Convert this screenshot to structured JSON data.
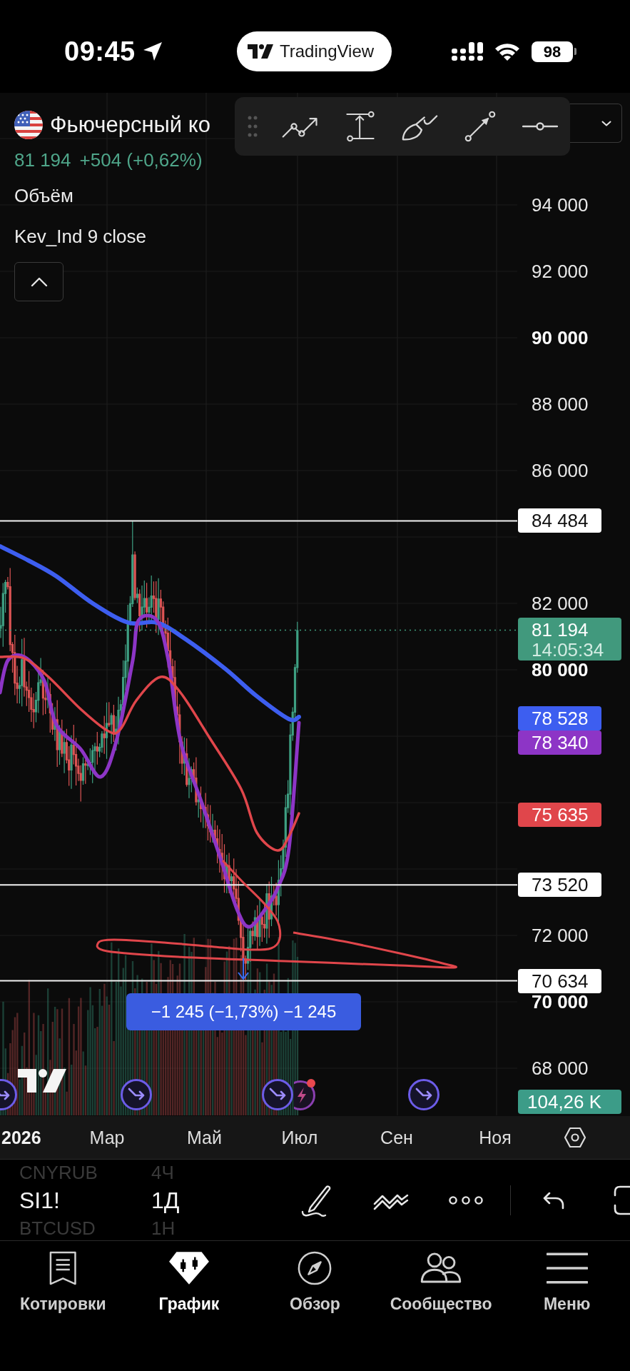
{
  "status_bar": {
    "time": "09:45",
    "app_name": "TradingView",
    "battery": "98"
  },
  "symbol": {
    "name": "Фьючерсный ко",
    "price": "81 194",
    "change": "+504 (+0,62%)"
  },
  "legend": [
    "Объём",
    "Kev_Ind 9 close"
  ],
  "chart": {
    "price_axis": [
      {
        "label": "94 000",
        "major": false
      },
      {
        "label": "92 000",
        "major": false
      },
      {
        "label": "90 000",
        "major": true
      },
      {
        "label": "88 000",
        "major": false
      },
      {
        "label": "86 000",
        "major": false
      },
      {
        "label": "82 000",
        "major": false
      },
      {
        "label": "80 000",
        "major": true
      },
      {
        "label": "72 000",
        "major": false
      },
      {
        "label": "70 000",
        "major": true
      },
      {
        "label": "68 000",
        "major": false
      }
    ],
    "levels": [
      "84 484",
      "73 520",
      "70 634"
    ],
    "last_price": {
      "price": "81 194",
      "countdown": "14:05:34"
    },
    "indicators": [
      {
        "value": "78 528",
        "color": "#3d5ef0"
      },
      {
        "value": "78 340",
        "color": "#8d35c6"
      },
      {
        "value": "75 635",
        "color": "#e0464b"
      }
    ],
    "volume": "104,26 K",
    "measure": "−1 245 (−1,73%) −1 245",
    "time_axis": [
      {
        "label": "2026",
        "major": true
      },
      {
        "label": "Мар",
        "major": false
      },
      {
        "label": "Май",
        "major": false
      },
      {
        "label": "Июл",
        "major": false
      },
      {
        "label": "Сен",
        "major": false
      },
      {
        "label": "Ноя",
        "major": false
      }
    ]
  },
  "symbol_picker": [
    {
      "symbol": "CNYRUB",
      "interval": "4Ч",
      "selected": false
    },
    {
      "symbol": "SI1!",
      "interval": "1Д",
      "selected": true
    },
    {
      "symbol": "BTCUSD",
      "interval": "1Н",
      "selected": false
    }
  ],
  "tab_bar": [
    {
      "label": "Котировки",
      "selected": false
    },
    {
      "label": "График",
      "selected": true
    },
    {
      "label": "Обзор",
      "selected": false
    },
    {
      "label": "Сообщество",
      "selected": false
    },
    {
      "label": "Меню",
      "selected": false
    }
  ]
}
